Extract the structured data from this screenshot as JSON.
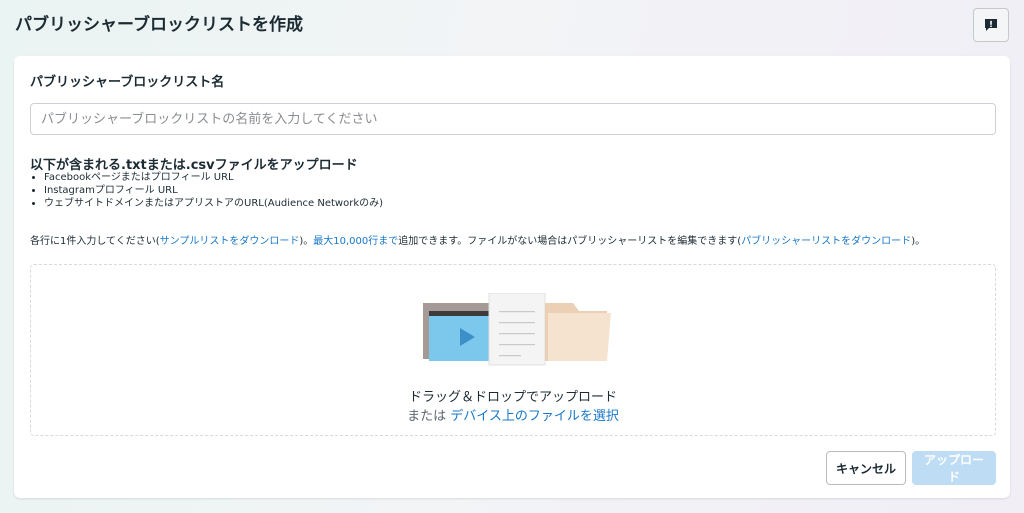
{
  "header": {
    "title": "パブリッシャーブロックリストを作成",
    "feedback_icon": "feedback-icon"
  },
  "form": {
    "name_label": "パブリッシャーブロックリスト名",
    "name_placeholder": "パブリッシャーブロックリストの名前を入力してください",
    "name_value": "",
    "file_title": "以下が含まれる.txtまたは.csvファイルをアップロード",
    "requirements": [
      "Facebookページまたはプロフィール URL",
      "Instagramプロフィール URL",
      "ウェブサイトドメインまたはアプリストアのURL(Audience Networkのみ)"
    ],
    "instructions": {
      "part1": "各行に1件入力してください(",
      "sample_link": "サンプルリストをダウンロード",
      "part2": ")。",
      "limit_link": "最大10,000行まで",
      "part3": "追加できます。ファイルがない場合はパブリッシャーリストを編集できます(",
      "download_link": "パブリッシャーリストをダウンロード",
      "part4": ")。"
    }
  },
  "dropzone": {
    "title": "ドラッグ＆ドロップでアップロード",
    "or_text": "または",
    "select_link": "デバイス上のファイルを選択"
  },
  "actions": {
    "cancel": "キャンセル",
    "upload": "アップロード"
  },
  "colors": {
    "link": "#1877c9",
    "upload_disabled": "#bfdcf5",
    "illustration_blue": "#7cc8ec",
    "illustration_beige": "#f2dcc6"
  }
}
